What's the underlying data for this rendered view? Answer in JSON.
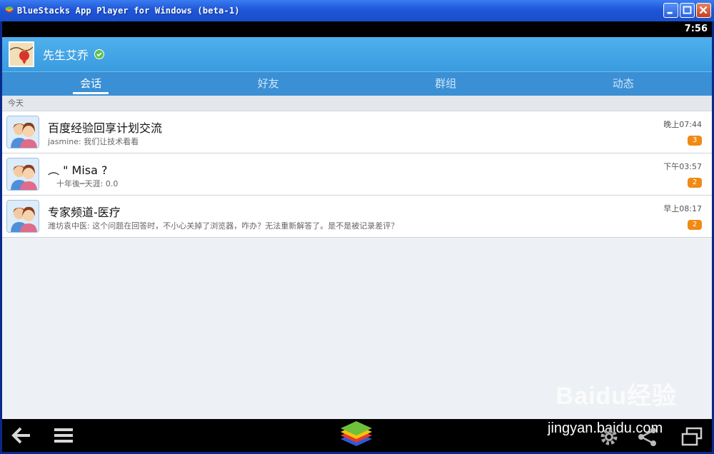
{
  "window": {
    "title": "BlueStacks App Player for Windows (beta-1)"
  },
  "status_bar": {
    "time": "7:56"
  },
  "header": {
    "username": "先生艾乔"
  },
  "tabs": [
    {
      "label": "会话",
      "active": true
    },
    {
      "label": "好友",
      "active": false
    },
    {
      "label": "群组",
      "active": false
    },
    {
      "label": "动态",
      "active": false
    }
  ],
  "section_label": "今天",
  "conversations": [
    {
      "name": "百度经验回享计划交流",
      "message": "jasmine: 我们让技术看看",
      "time": "晚上07:44",
      "unread": "3"
    },
    {
      "name": "︵ \" Misa ?",
      "message": "十年後┅天涯: 0.0",
      "time": "下午03:57",
      "unread": "2"
    },
    {
      "name": "专家频道-医疗",
      "message": "潍坊袁中医: 这个问题在回答时，不小心关掉了浏览器，咋办？无法重新解答了。是不是被记录差评？",
      "time": "早上08:17",
      "unread": "2"
    }
  ],
  "watermark": {
    "brand": "Baidu经验",
    "url": "jingyan.baidu.com"
  },
  "colors": {
    "header_blue": "#3a9be0",
    "tab_bar": "#3b8fd4",
    "badge_orange": "#f08a14",
    "verified_green": "#5cc24a"
  },
  "icons": {
    "back": "back-arrow-icon",
    "menu": "menu-icon",
    "home": "bluestacks-logo-icon",
    "settings": "gear-icon",
    "share": "share-icon",
    "fullscreen": "fullscreen-icon"
  }
}
